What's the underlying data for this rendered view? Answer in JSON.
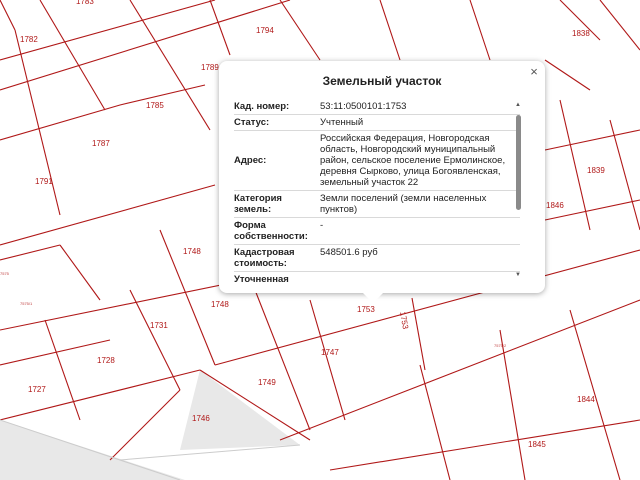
{
  "map": {
    "colors": {
      "boundary": "#b01818",
      "label": "#b01818",
      "road": "#e6e6e6"
    },
    "parcels": [
      "1783",
      "1782",
      "1794",
      "1838",
      "1789",
      "1785",
      "1787",
      "1791",
      "1839",
      "1748",
      "1748",
      "1731",
      "1728",
      "1727",
      "1753",
      "1753",
      "1747",
      "1749",
      "1746",
      "1845",
      "1844",
      "1846"
    ],
    "small_labels": [
      "7575/1",
      "7575/2",
      "7575"
    ]
  },
  "popup": {
    "title": "Земельный участок",
    "close_icon": "×",
    "rows": [
      {
        "label": "Кад. номер:",
        "value": "53:11:0500101:1753"
      },
      {
        "label": "Статус:",
        "value": "Учтенный"
      },
      {
        "label": "Адрес:",
        "value": "Российская Федерация, Новгородская область, Новгородский муниципальный район, сельское поселение Ермолинское, деревня Сырково, улица Богоявленская, земельный участок 22"
      },
      {
        "label": "Категория земель:",
        "value": "Земли поселений (земли населенных пунктов)"
      },
      {
        "label": "Форма собственности:",
        "value": "-"
      },
      {
        "label": "Кадастровая стоимость:",
        "value": "548501.6 руб"
      },
      {
        "label": "Уточненная",
        "value": ""
      }
    ],
    "scroll_up_icon": "▲",
    "scroll_down_icon": "▼"
  }
}
